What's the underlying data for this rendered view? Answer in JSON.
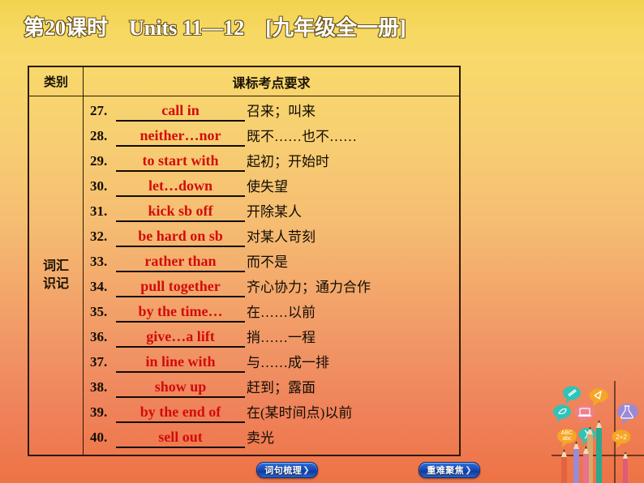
{
  "header": {
    "title": "第20课时　Units 11—12　[九年级全一册]"
  },
  "table": {
    "col_headers": {
      "category": "类别",
      "requirement": "课标考点要求"
    },
    "category_label_lines": [
      "词汇",
      "识记"
    ],
    "rows": [
      {
        "num": "27.",
        "term": "call in",
        "meaning": "召来；叫来"
      },
      {
        "num": "28.",
        "term": "neither…nor",
        "meaning": "既不……也不……"
      },
      {
        "num": "29.",
        "term": "to start with",
        "meaning": "起初；开始时"
      },
      {
        "num": "30.",
        "term": "let…down",
        "meaning": "使失望"
      },
      {
        "num": "31.",
        "term": "kick sb off",
        "meaning": "开除某人"
      },
      {
        "num": "32.",
        "term": "be hard on sb",
        "meaning": "对某人苛刻"
      },
      {
        "num": "33.",
        "term": "rather than",
        "meaning": "而不是"
      },
      {
        "num": "34.",
        "term": "pull together",
        "meaning": "齐心协力；通力合作"
      },
      {
        "num": "35.",
        "term": "by the time…",
        "meaning": "在……以前"
      },
      {
        "num": "36.",
        "term": "give…a lift",
        "meaning": "捎……一程"
      },
      {
        "num": "37.",
        "term": "in line with",
        "meaning": "与……成一排"
      },
      {
        "num": "38.",
        "term": "show up",
        "meaning": "赶到；露面"
      },
      {
        "num": "39.",
        "term": "by the end of",
        "meaning": "在(某时间点)以前"
      },
      {
        "num": "40.",
        "term": "sell out",
        "meaning": "卖光"
      }
    ]
  },
  "footer": {
    "left_button": {
      "label": "词句梳理",
      "arrow": "❯"
    },
    "right_button": {
      "label": "重难聚焦",
      "arrow": "❯"
    }
  },
  "decoration": {
    "name": "pencils-and-speech-bubbles-art",
    "bubble_icons": [
      "pencil-icon",
      "leaf-icon",
      "laptop-icon",
      "checkmark-icon",
      "abc-icon",
      "dna-icon",
      "flask-icon",
      "math-icon"
    ],
    "math_text": "2+2",
    "abc_text": "ABC"
  },
  "colors": {
    "term_red": "#d30b0b",
    "ink_black": "#120c04",
    "bg_top": "#f3d34e",
    "bg_bottom": "#ee7345",
    "button_blue": "#1b4fbe"
  }
}
